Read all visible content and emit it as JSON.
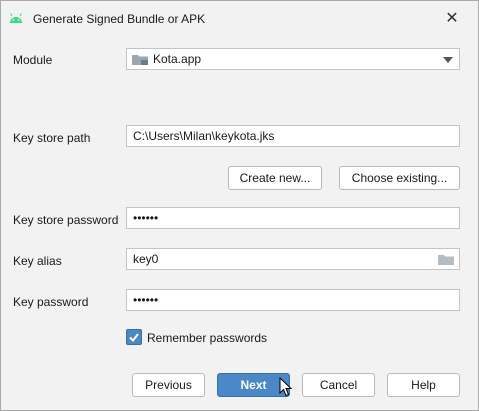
{
  "window": {
    "title": "Generate Signed Bundle or APK",
    "close_glyph": "✕"
  },
  "module": {
    "label": "Module",
    "value": "Kota.app"
  },
  "key_store_path": {
    "label": "Key store path",
    "value": "C:\\Users\\Milan\\keykota.jks"
  },
  "buttons": {
    "create_new": "Create new...",
    "choose_existing": "Choose existing...",
    "previous": "Previous",
    "next": "Next",
    "cancel": "Cancel",
    "help": "Help"
  },
  "key_store_password": {
    "label": "Key store password",
    "value": "••••••"
  },
  "key_alias": {
    "label": "Key alias",
    "value": "key0"
  },
  "key_password": {
    "label": "Key password",
    "value": "••••••"
  },
  "remember_passwords": {
    "label": "Remember passwords",
    "checked": true
  },
  "colors": {
    "accent": "#4a88c7",
    "android_green": "#3ddc84"
  },
  "icons": [
    "android-icon",
    "close-icon",
    "module-folder-icon",
    "chevron-down-icon",
    "folder-browse-icon",
    "checkmark-icon",
    "mouse-cursor-icon"
  ]
}
